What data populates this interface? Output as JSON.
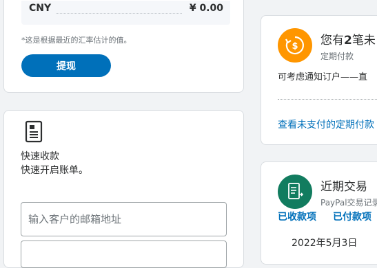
{
  "balance": {
    "currency_code": "CNY",
    "amount": "¥ 0.00",
    "note": "*这是根据最近的汇率估计的值。",
    "withdraw_label": "提现"
  },
  "invoice": {
    "icon": "document-icon",
    "title": "快速收款",
    "subtitle": "快速开启账单。",
    "email_placeholder": "输入客户的邮箱地址"
  },
  "recurring": {
    "icon": "recurring-payment-icon",
    "title_prefix": "您有",
    "title_count": "2",
    "title_suffix": "笔未",
    "subtitle": "定期付款",
    "description": "可考虑通知订户——直",
    "link": "查看未支付的定期付款"
  },
  "activity": {
    "icon": "activity-icon",
    "title": "近期交易",
    "subtitle": "PayPal交易记录",
    "tabs": [
      {
        "label": "已收款项"
      },
      {
        "label": "已付款项"
      }
    ],
    "date": "2022年5月3日"
  },
  "colors": {
    "primary_blue": "#0070ba",
    "orange": "#ff9600",
    "green": "#127c5f"
  }
}
